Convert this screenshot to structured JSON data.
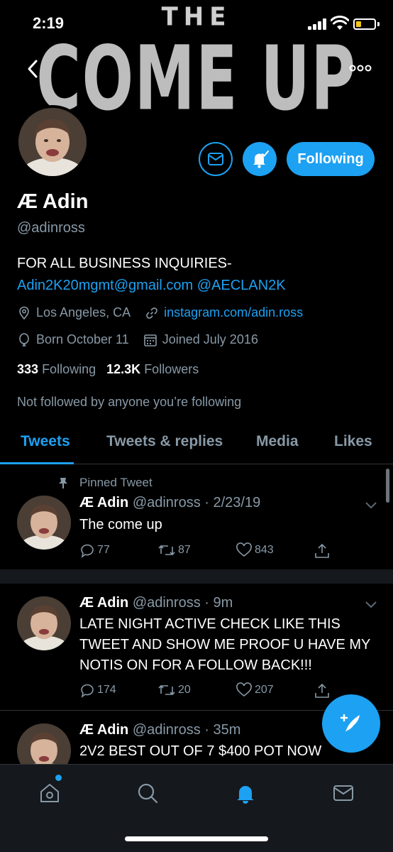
{
  "status_bar": {
    "time": "2:19"
  },
  "banner": {
    "line1": "THE",
    "line2": "COME UP"
  },
  "header": {
    "back_icon": "chevron-left-icon",
    "more_icon": "more-dots-icon"
  },
  "profile": {
    "display_name": "Æ Adin",
    "handle": "@adinross",
    "bio_line1": "FOR ALL BUSINESS INQUIRIES-",
    "bio_email": "Adin2K20mgmt@gmail.com",
    "bio_mention": "@AECLAN2K",
    "location": "Los Angeles, CA",
    "website": "instagram.com/adin.ross",
    "birthday": "Born October 11",
    "joined": "Joined July 2016",
    "following_count": "333",
    "following_label": "Following",
    "followers_count": "12.3K",
    "followers_label": "Followers",
    "not_followed_text": "Not followed by anyone you’re following",
    "follow_button_label": "Following"
  },
  "colors": {
    "accent": "#1da1f2",
    "muted": "#8899a6",
    "background": "#000000"
  },
  "tabs": [
    {
      "label": "Tweets",
      "active": true
    },
    {
      "label": "Tweets & replies",
      "active": false
    },
    {
      "label": "Media",
      "active": false
    },
    {
      "label": "Likes",
      "active": false
    }
  ],
  "pinned_label": "Pinned Tweet",
  "tweets": [
    {
      "name": "Æ Adin",
      "handle_time": "@adinross · 2/23/19",
      "text": "The come up",
      "replies": "77",
      "retweets": "87",
      "likes": "843"
    },
    {
      "name": "Æ Adin",
      "handle_time": "@adinross · 9m",
      "text": "LATE NIGHT ACTIVE CHECK LIKE THIS TWEET AND SHOW ME PROOF U HAVE MY NOTIS ON FOR A FOLLOW BACK!!!",
      "replies": "174",
      "retweets": "20",
      "likes": "207"
    },
    {
      "name": "Æ Adin",
      "handle_time": "@adinross · 35m",
      "text": "2V2 BEST OUT OF 7 $400 POT NOW"
    }
  ],
  "bottom_nav": [
    {
      "icon": "home-icon"
    },
    {
      "icon": "search-icon"
    },
    {
      "icon": "notifications-icon",
      "active": true
    },
    {
      "icon": "messages-icon"
    }
  ]
}
